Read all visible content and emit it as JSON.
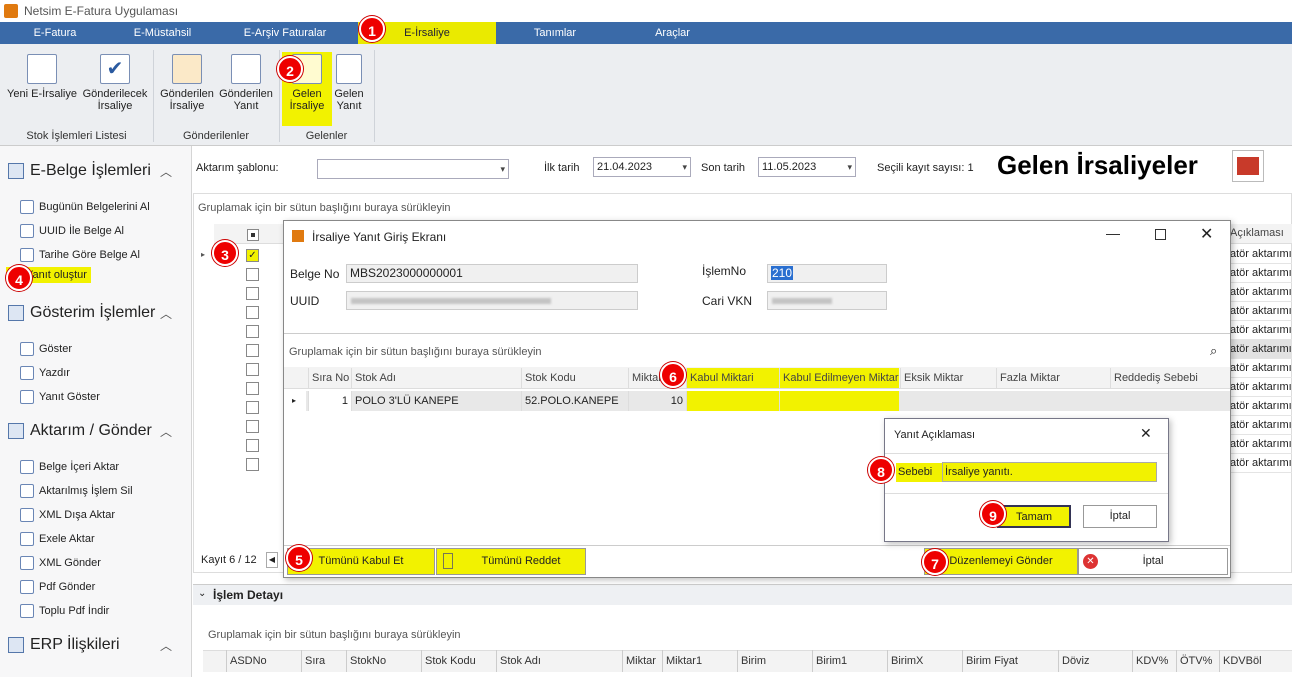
{
  "app": {
    "title": "Netsim E-Fatura Uygulaması"
  },
  "menu": {
    "tabs": [
      "E-Fatura",
      "E-Müstahsil",
      "E-Arşiv Faturalar",
      "E-İrsaliye",
      "Tanımlar",
      "Araçlar"
    ]
  },
  "ribbon": {
    "buttons": [
      {
        "line1": "Yeni E-İrsaliye",
        "line2": ""
      },
      {
        "line1": "Gönderilecek",
        "line2": "İrsaliye"
      },
      {
        "line1": "Gönderilen",
        "line2": "İrsaliye"
      },
      {
        "line1": "Gönderilen",
        "line2": "Yanıt"
      },
      {
        "line1": "Gelen",
        "line2": "İrsaliye"
      },
      {
        "line1": "Gelen",
        "line2": "Yanıt"
      }
    ],
    "groups": [
      "Stok İşlemleri Listesi",
      "Gönderilenler",
      "Gelenler"
    ]
  },
  "badges": [
    "1",
    "2",
    "3",
    "4",
    "5",
    "6",
    "7",
    "8",
    "9"
  ],
  "sidebar": {
    "groups": [
      {
        "title": "E-Belge İşlemleri",
        "items": [
          "Bugünün Belgelerini Al",
          "UUID İle Belge Al",
          "Tarihe Göre Belge Al",
          "Yanıt oluştur"
        ]
      },
      {
        "title": "Gösterim İşlemler",
        "items": [
          "Göster",
          "Yazdır",
          "Yanıt Göster"
        ]
      },
      {
        "title": "Aktarım / Gönder",
        "items": [
          "Belge İçeri Aktar",
          "Aktarılmış İşlem Sil",
          "XML Dışa Aktar",
          "Exele Aktar",
          "XML Gönder",
          "Pdf Gönder",
          "Toplu Pdf İndir"
        ]
      },
      {
        "title": "ERP İlişkileri",
        "items": []
      }
    ]
  },
  "filter": {
    "template_label": "Aktarım şablonu:",
    "template_value": "",
    "start_label": "İlk tarih",
    "start_date": "21.04.2023",
    "end_label": "Son tarih",
    "end_date": "11.05.2023",
    "selected_label": "Seçili kayıt sayısı: 1",
    "page_title": "Gelen İrsaliyeler"
  },
  "grid": {
    "group_hint": "Gruplamak için bir sütun başlığını buraya sürükleyin",
    "right_header": "Açıklaması",
    "right_cells": [
      "atör aktarımı",
      "atör aktarımı",
      "atör aktarımı",
      "atör aktarımı",
      "atör aktarımı",
      "atör aktarımı",
      "atör aktarımı",
      "atör aktarımı",
      "atör aktarımı",
      "atör aktarımı",
      "atör aktarımı",
      "atör aktarımı"
    ],
    "record": "Kayıt 6 / 12"
  },
  "detail": {
    "title": "İşlem Detayı",
    "group_hint": "Gruplamak için bir sütun başlığını buraya sürükleyin",
    "columns": [
      "ASDNo",
      "Sıra",
      "StokNo",
      "Stok Kodu",
      "Stok Adı",
      "Miktar",
      "Miktar1",
      "Birim",
      "Birim1",
      "BirimX",
      "Birim Fiyat",
      "Döviz",
      "KDV%",
      "ÖTV%",
      "KDVBöl"
    ]
  },
  "dialog": {
    "title": "İrsaliye Yanıt Giriş Ekranı",
    "belge_label": "Belge No",
    "belge_value": "MBS2023000000001",
    "uuid_label": "UUID",
    "uuid_value": "",
    "islem_label": "İşlemNo",
    "islem_value": "210",
    "vkn_label": "Cari VKN",
    "vkn_value": "",
    "group_hint": "Gruplamak için bir sütun başlığını buraya sürükleyin",
    "columns": [
      "Sıra No",
      "Stok Adı",
      "Stok Kodu",
      "Miktar",
      "Kabul Miktari",
      "Kabul Edilmeyen Miktar",
      "Eksik Miktar",
      "Fazla Miktar",
      "Reddediş Sebebi"
    ],
    "row": {
      "sira": "1",
      "stok_adi": "POLO 3'LÜ KANEPE",
      "stok_kodu": "52.POLO.KANEPE",
      "miktar": "10"
    },
    "accept_all": "Tümünü Kabul Et",
    "reject_all": "Tümünü Reddet",
    "send": "Düzenlemeyi Gönder",
    "cancel": "İptal"
  },
  "subdialog": {
    "title": "Yanıt Açıklaması",
    "reason_label": "Sebebi",
    "reason_value": "İrsaliye yanıtı.",
    "ok": "Tamam",
    "cancel": "İptal"
  }
}
